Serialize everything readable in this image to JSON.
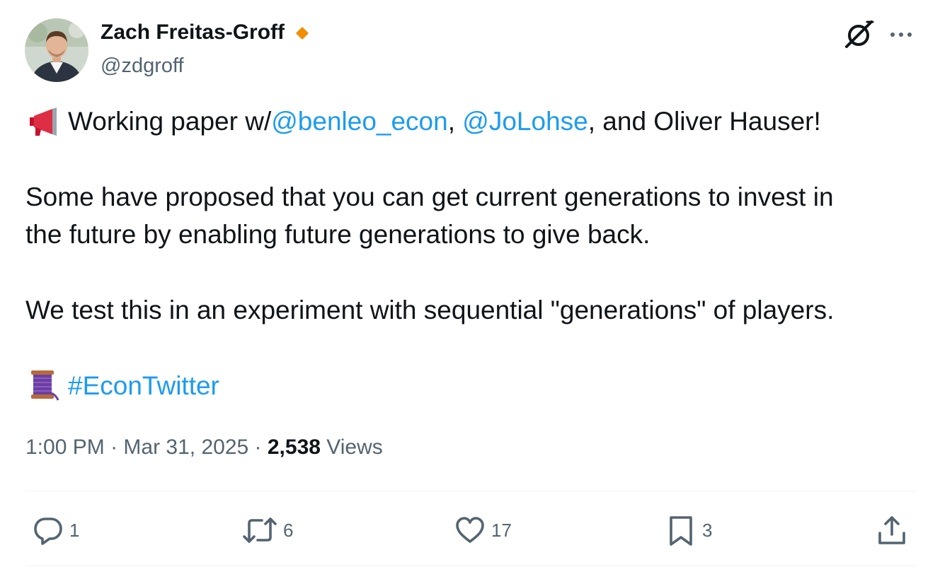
{
  "author": {
    "name": "Zach Freitas-Groff",
    "handle": "@zdgroff",
    "badge_color": "#f28c00"
  },
  "header_icons": {
    "grok": "grok-icon",
    "more": "more-icon"
  },
  "tweet": {
    "line1": {
      "emoji": "megaphone-icon",
      "prefix": "Working paper w/",
      "mention1": "@benleo_econ",
      "sep1": ", ",
      "mention2": "@JoLohse",
      "suffix": ", and Oliver Hauser!"
    },
    "line2": "Some have proposed that you can get current generations to invest in",
    "line3": "the future by enabling future generations to give back.",
    "line4": "We test this in an experiment with sequential \"generations\" of players.",
    "line5": {
      "emoji": "thread-spool-icon",
      "hashtag": "#EconTwitter"
    }
  },
  "meta": {
    "time": "1:00 PM",
    "sep1": " · ",
    "date": "Mar 31, 2025",
    "sep2": " · ",
    "views_count": "2,538",
    "views_label": " Views"
  },
  "actions": {
    "reply": {
      "icon": "reply-icon",
      "count": "1"
    },
    "retweet": {
      "icon": "retweet-icon",
      "count": "6"
    },
    "like": {
      "icon": "heart-icon",
      "count": "17"
    },
    "bookmark": {
      "icon": "bookmark-icon",
      "count": "3"
    },
    "share": {
      "icon": "share-icon"
    }
  },
  "colors": {
    "text": "#0f1419",
    "secondary": "#536471",
    "link": "#1d9bf0",
    "divider": "#eff3f4"
  }
}
